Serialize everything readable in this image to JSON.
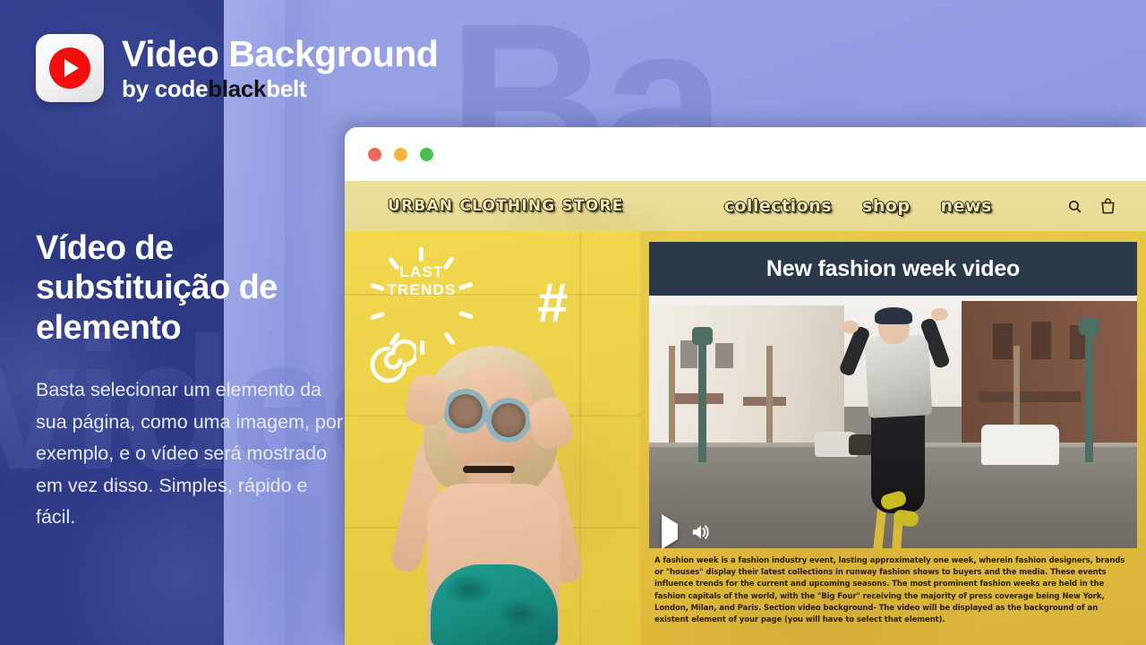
{
  "header": {
    "logo_icon": "play-button-icon",
    "title": "Video Background",
    "by_label": "by",
    "brand_code": "code",
    "brand_black": "black",
    "brand_belt": "belt"
  },
  "promo": {
    "heading": "Vídeo de substituição de elemento",
    "body": "Basta selecionar um elemento da sua página, como uma imagem, por exemplo, e o vídeo será mostrado em vez disso. Simples, rápido e fácil."
  },
  "browser": {
    "traffic_lights": [
      "red",
      "amber",
      "green"
    ]
  },
  "site": {
    "brand": "URBAN CLOTHING STORE",
    "nav_links": [
      {
        "label": "collections"
      },
      {
        "label": "shop"
      },
      {
        "label": "news"
      }
    ],
    "icons": [
      {
        "name": "search-icon"
      },
      {
        "name": "shopping-bag-icon"
      }
    ]
  },
  "hero": {
    "badge_line1": "LAST",
    "badge_line2": "TRENDS",
    "hash_symbol": "#"
  },
  "video": {
    "title": "New fashion week video",
    "play_icon": "play-icon",
    "volume_icon": "volume-icon",
    "description": "A fashion week is a fashion industry event, lasting approximately one week, wherein fashion designers, brands or \"houses\" display their latest collections in runway fashion shows to buyers and the media. These events influence trends for the current and upcoming seasons. The most prominent fashion weeks are held in the fashion capitals of the world, with the \"Big Four\" receiving the majority of press coverage being New York, London, Milan, and Paris. Section video background- The video will be displayed as the background of an existent element of your page (you will have to select that element)."
  },
  "colors": {
    "promo_dark": "#2e3b8a",
    "promo_light": "#9aa4e6",
    "nav_yellow": "#ece0a0",
    "panel_gold": "#e5c241",
    "video_title_bar": "#2b3a4a",
    "logo_red": "#f40d0d"
  },
  "decor": {
    "ghost_text": "Ba",
    "ghost_text2": "video"
  }
}
